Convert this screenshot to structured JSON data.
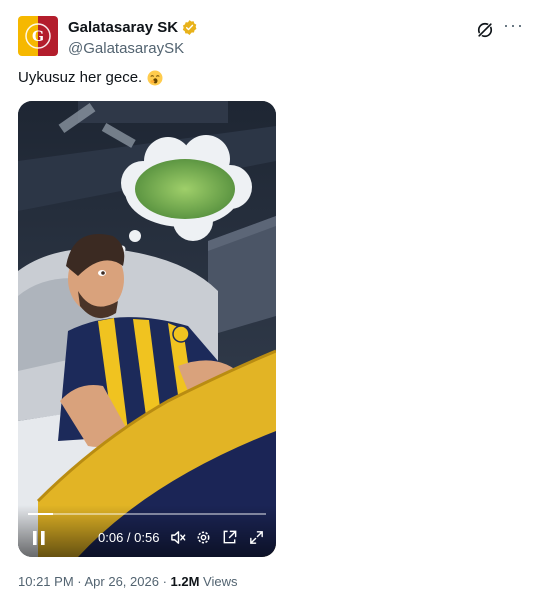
{
  "author": {
    "display_name": "Galatasaray SK",
    "handle": "@GalatasaraySK",
    "avatar_icon": "galatasaray-logo",
    "verified_icon": "verified-gold-badge-icon"
  },
  "tweet": {
    "text": "Uykusuz her gece.",
    "emoji": "yawning-face-emoji"
  },
  "video": {
    "elapsed": "0:06",
    "duration": "0:56",
    "time_display": "0:06 / 0:56",
    "progress": 0.107
  },
  "meta": {
    "time": "10:21 PM",
    "separator": " · ",
    "date": "Apr 26, 2026",
    "views_count": "1.2M",
    "views_label": " Views"
  },
  "colors": {
    "text": "#0f1419",
    "secondary": "#536471",
    "verified_gold": "#e8b21a",
    "gs_yellow": "#f6b800",
    "gs_red": "#b31d2c"
  }
}
